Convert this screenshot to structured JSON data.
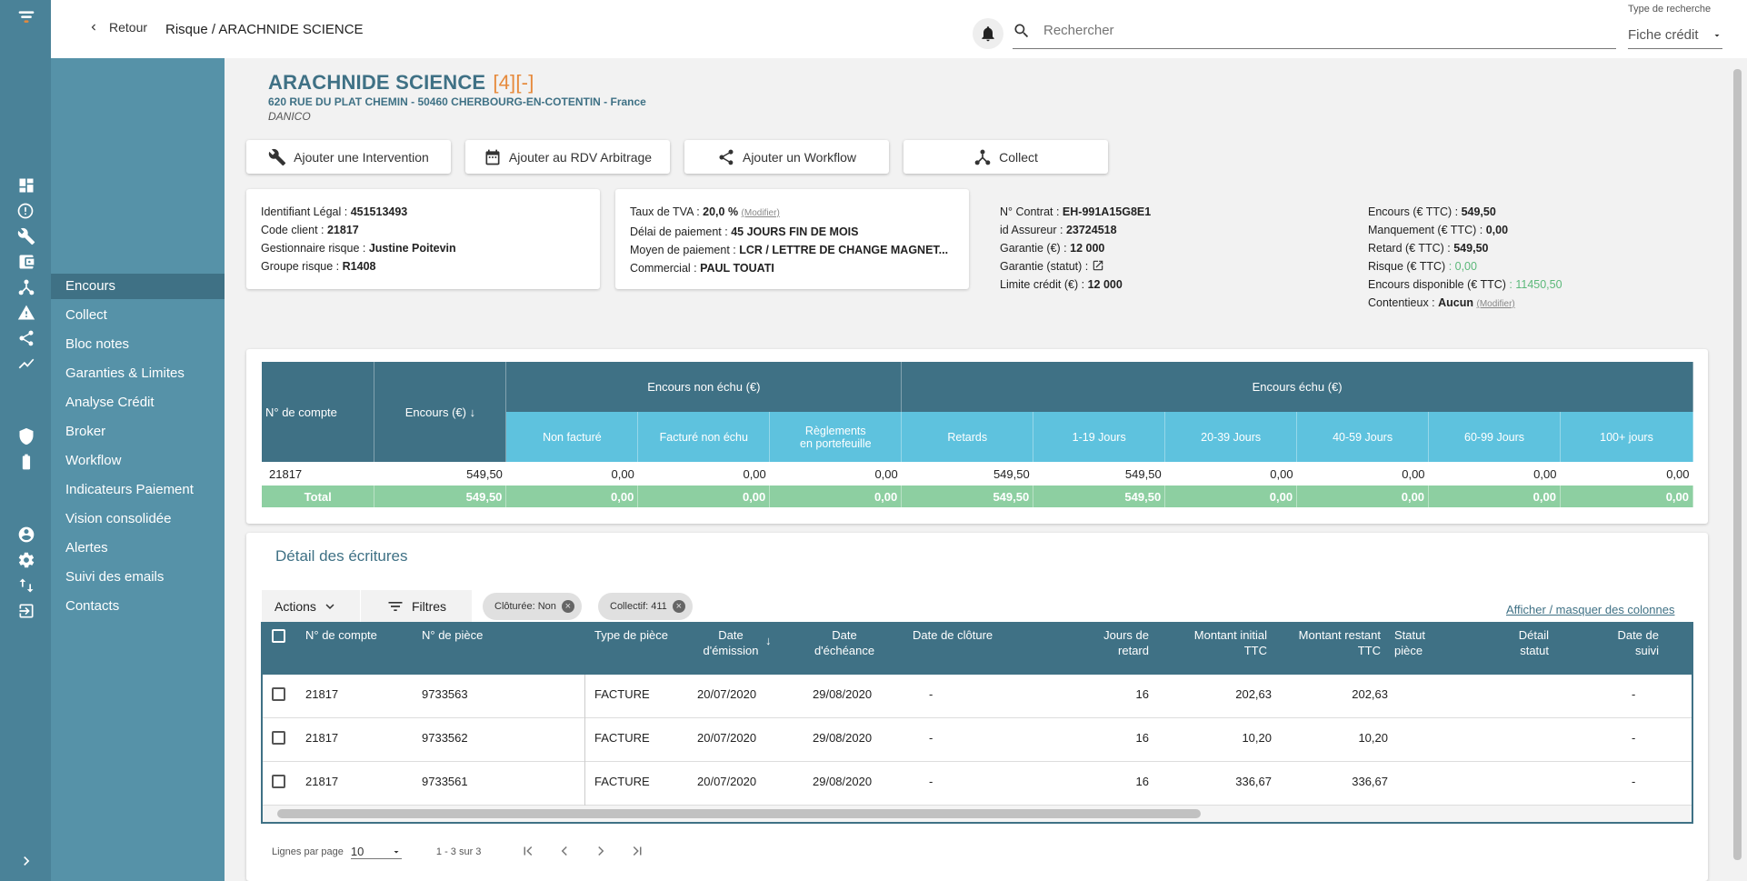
{
  "topbar": {
    "back_label": "Retour",
    "breadcrumb": "Risque / ARACHNIDE SCIENCE",
    "search_placeholder": "Rechercher",
    "search_type_label": "Type de recherche",
    "search_type_value": "Fiche crédit"
  },
  "rail_icons": [
    "logo-icon",
    "dashboard-icon",
    "alert-circle-icon",
    "wrench-icon",
    "wallet-icon",
    "network-icon",
    "warning-icon",
    "share-icon",
    "trend-icon",
    "shield-icon",
    "battery-icon",
    "user-icon",
    "settings-icon",
    "transfer-icon",
    "logout-icon",
    "expand-icon"
  ],
  "sidebar": {
    "items": [
      {
        "label": "Encours",
        "active": true
      },
      {
        "label": "Collect"
      },
      {
        "label": "Bloc notes"
      },
      {
        "label": "Garanties & Limites"
      },
      {
        "label": "Analyse Crédit"
      },
      {
        "label": "Broker"
      },
      {
        "label": "Workflow"
      },
      {
        "label": "Indicateurs Paiement"
      },
      {
        "label": "Vision consolidée"
      },
      {
        "label": "Alertes"
      },
      {
        "label": "Suivi des emails"
      },
      {
        "label": "Contacts"
      }
    ]
  },
  "client": {
    "name": "ARACHNIDE SCIENCE",
    "tag": "[4][-]",
    "address": "620 RUE DU PLAT CHEMIN - 50460 CHERBOURG-EN-COTENTIN - France",
    "subtitle": "DANICO"
  },
  "actions": {
    "add_intervention": "Ajouter une Intervention",
    "add_rdv": "Ajouter au RDV Arbitrage",
    "add_workflow": "Ajouter un Workflow",
    "collect": "Collect"
  },
  "info1": {
    "l1": "Identifiant Légal : ",
    "v1": "451513493",
    "l2": "Code client : ",
    "v2": "21817",
    "l3": "Gestionnaire risque : ",
    "v3": "Justine Poitevin",
    "l4": "Groupe risque : ",
    "v4": "R1408"
  },
  "info2": {
    "l1": "Taux de TVA : ",
    "v1": "20,0 %",
    "modify": "(Modifier)",
    "l2": "Délai de paiement : ",
    "v2": "45 JOURS FIN DE MOIS",
    "l3": "Moyen de paiement : ",
    "v3": "LCR / LETTRE DE CHANGE MAGNET...",
    "l4": "Commercial : ",
    "v4": "PAUL TOUATI"
  },
  "info3": {
    "l1": "N° Contrat : ",
    "v1": "EH-991A15G8E1",
    "l2": "id Assureur : ",
    "v2": "23724518",
    "l3": "Garantie (€) : ",
    "v3": "12 000",
    "l4": "Garantie (statut) : ",
    "l5": "Limite crédit (€) : ",
    "v5": "12 000"
  },
  "info4": {
    "l1": "Encours (€ TTC) : ",
    "v1": "549,50",
    "l2": "Manquement (€ TTC) : ",
    "v2": "0,00",
    "l3": "Retard (€ TTC) : ",
    "v3": "549,50",
    "l4": "Risque (€ TTC) ",
    "v4": ": 0,00",
    "l5": "Encours disponible (€ TTC) ",
    "v5": ": 11450,50",
    "l6": "Contentieux : ",
    "v6": "Aucun",
    "modify": "(Modifier)"
  },
  "encours_table": {
    "h_account": "N° de compte",
    "h_encours": "Encours (€)",
    "h_non_echu": "Encours non échu (€)",
    "h_echu": "Encours échu (€)",
    "sub_headers": [
      "Non facturé",
      "Facturé non échu",
      "Règlements en portefeuille",
      "Retards",
      "1-19 Jours",
      "20-39 Jours",
      "40-59 Jours",
      "60-99 Jours",
      "100+ jours"
    ],
    "row": [
      "21817",
      "549,50",
      "0,00",
      "0,00",
      "0,00",
      "549,50",
      "549,50",
      "0,00",
      "0,00",
      "0,00",
      "0,00"
    ],
    "total": [
      "Total",
      "549,50",
      "0,00",
      "0,00",
      "0,00",
      "549,50",
      "549,50",
      "0,00",
      "0,00",
      "0,00",
      "0,00"
    ]
  },
  "detail": {
    "title": "Détail des écritures",
    "actions_label": "Actions",
    "filters_label": "Filtres",
    "chip1_key": "Clôturée: ",
    "chip1_val": "Non",
    "chip2_key": "Collectif: ",
    "chip2_val": "411",
    "toggle_columns": "Afficher / masquer des colonnes",
    "headers": [
      "N° de compte",
      "N° de pièce",
      "Type de pièce",
      "Date d'émission",
      "Date d'échéance",
      "Date de clôture",
      "Jours de retard",
      "Montant initial TTC",
      "Montant restant TTC",
      "Statut pièce",
      "Détail statut",
      "Date de suivi"
    ],
    "rows": [
      [
        "21817",
        "9733563",
        "FACTURE",
        "20/07/2020",
        "29/08/2020",
        "-",
        "16",
        "202,63",
        "202,63",
        "",
        "",
        "-"
      ],
      [
        "21817",
        "9733562",
        "FACTURE",
        "20/07/2020",
        "29/08/2020",
        "-",
        "16",
        "10,20",
        "10,20",
        "",
        "",
        "-"
      ],
      [
        "21817",
        "9733561",
        "FACTURE",
        "20/07/2020",
        "29/08/2020",
        "-",
        "16",
        "336,67",
        "336,67",
        "",
        "",
        "-"
      ]
    ]
  },
  "pager": {
    "rows_label": "Lignes par page",
    "rows_value": "10",
    "range": "1 - 3 sur 3"
  },
  "colors": {
    "primary": "#3f7185",
    "rail": "#4a8298",
    "subnav": "#5692a8",
    "light_header": "#5ec2de",
    "total_row": "#8dcfa1",
    "accent": "#e68a3c"
  }
}
